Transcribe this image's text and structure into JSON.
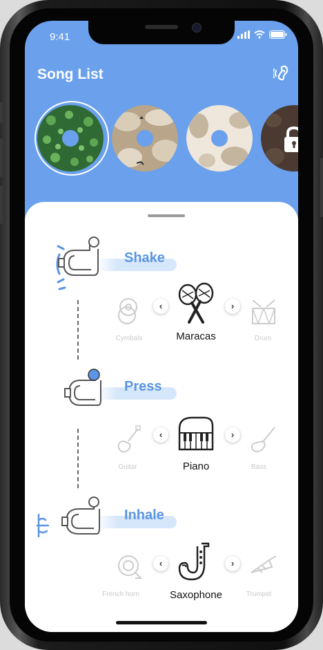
{
  "status_bar": {
    "time": "9:41"
  },
  "header": {
    "title": "Song List",
    "hearing_icon": "ear-sound-icon"
  },
  "songs": [
    {
      "name": "song-disc-clover",
      "selected": true,
      "locked": false,
      "color": "#2f6a34"
    },
    {
      "name": "song-disc-cats",
      "selected": false,
      "locked": false,
      "color": "#b8a58a"
    },
    {
      "name": "song-disc-light",
      "selected": false,
      "locked": false,
      "color": "#efe7dc"
    },
    {
      "name": "song-disc-locked",
      "selected": false,
      "locked": true,
      "color": "#4a3a32"
    }
  ],
  "gestures": [
    {
      "label": "Shake",
      "instrument": {
        "left": "Cymbals",
        "center": "Maracas",
        "right": "Drum"
      }
    },
    {
      "label": "Press",
      "instrument": {
        "left": "Guitar",
        "center": "Piano",
        "right": "Bass"
      }
    },
    {
      "label": "Inhale",
      "instrument": {
        "left": "French horn",
        "center": "Saxophone",
        "right": "Trumpet"
      }
    }
  ],
  "arrows": {
    "prev": "‹",
    "next": "›"
  },
  "colors": {
    "accent": "#6aa0ec",
    "label": "#5b95e3"
  }
}
